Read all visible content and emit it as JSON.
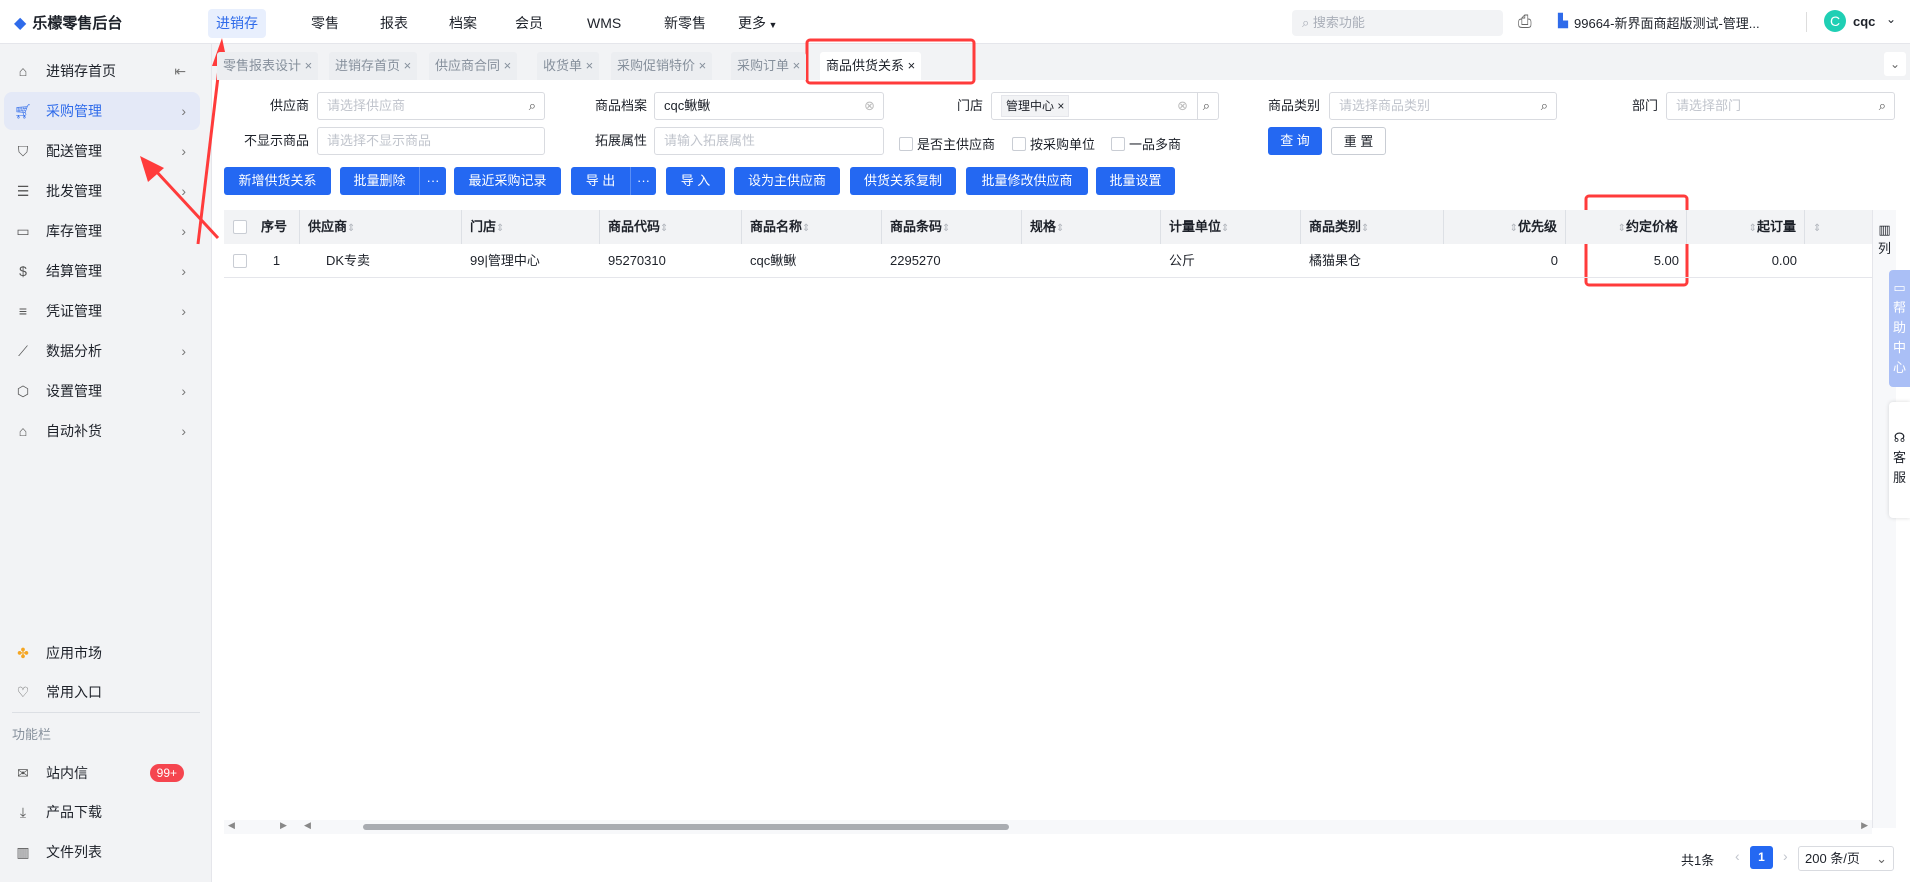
{
  "app": {
    "title": "乐檬零售后台"
  },
  "topnav": {
    "items": [
      {
        "label": "进销存",
        "active": true
      },
      {
        "label": "零售"
      },
      {
        "label": "报表"
      },
      {
        "label": "档案"
      },
      {
        "label": "会员"
      },
      {
        "label": "WMS"
      },
      {
        "label": "新零售"
      },
      {
        "label": "更多"
      }
    ],
    "search_placeholder": "搜索功能",
    "store": "99664-新界面商超版测试-管理...",
    "user_initial": "C",
    "user": "cqc"
  },
  "sidebar": {
    "items": [
      {
        "label": "进销存首页",
        "icon": "home-icon"
      },
      {
        "label": "采购管理",
        "icon": "cart-icon",
        "active": true
      },
      {
        "label": "配送管理",
        "icon": "map-icon"
      },
      {
        "label": "批发管理",
        "icon": "server-icon"
      },
      {
        "label": "库存管理",
        "icon": "inbox-icon"
      },
      {
        "label": "结算管理",
        "icon": "dollar-icon"
      },
      {
        "label": "凭证管理",
        "icon": "document-icon"
      },
      {
        "label": "数据分析",
        "icon": "chart-icon"
      },
      {
        "label": "设置管理",
        "icon": "settings-icon"
      },
      {
        "label": "自动补货",
        "icon": "robot-icon"
      }
    ],
    "bottom": {
      "app_market": "应用市场",
      "favorites": "常用入口",
      "section": "功能栏",
      "messages": "站内信",
      "messages_badge": "99+",
      "downloads": "产品下载",
      "files": "文件列表"
    }
  },
  "tabs": [
    {
      "label": "零售报表设计"
    },
    {
      "label": "进销存首页"
    },
    {
      "label": "供应商合同"
    },
    {
      "label": "收货单"
    },
    {
      "label": "采购促销特价"
    },
    {
      "label": "采购订单"
    },
    {
      "label": "商品供货关系",
      "active": true
    }
  ],
  "filters": {
    "supplier": {
      "label": "供应商",
      "placeholder": "请选择供应商"
    },
    "product": {
      "label": "商品档案",
      "value": "cqc鳅鳅"
    },
    "store": {
      "label": "门店",
      "chip": "管理中心"
    },
    "category": {
      "label": "商品类别",
      "placeholder": "请选择商品类别"
    },
    "dept": {
      "label": "部门",
      "placeholder": "请选择部门"
    },
    "hide_products": {
      "label": "不显示商品",
      "placeholder": "请选择不显示商品"
    },
    "ext": {
      "label": "拓展属性",
      "placeholder": "请输入拓展属性"
    },
    "checkboxes": [
      "是否主供应商",
      "按采购单位",
      "一品多商"
    ],
    "query": "查 询",
    "reset": "重 置"
  },
  "toolbar": [
    "新增供货关系",
    "批量删除",
    "最近采购记录",
    "导 出",
    "导 入",
    "设为主供应商",
    "供货关系复制",
    "批量修改供应商",
    "批量设置"
  ],
  "table": {
    "columns": [
      "序号",
      "供应商",
      "门店",
      "商品代码",
      "商品名称",
      "商品条码",
      "规格",
      "计量单位",
      "商品类别",
      "优先级",
      "约定价格",
      "起订量"
    ],
    "rows": [
      [
        "1",
        "DK专卖",
        "99|管理中心",
        "95270310",
        "cqc鳅鳅",
        "2295270",
        "",
        "公斤",
        "橘猫果仓",
        "0",
        "5.00",
        "0.00"
      ]
    ],
    "column_settings": "列"
  },
  "side_tabs": {
    "help": "帮助中心",
    "service": "客服"
  },
  "pagination": {
    "total": "共1条",
    "page": "1",
    "page_size": "200 条/页"
  },
  "colors": {
    "accent": "#2468f2",
    "annotation": "#ff3b3b"
  }
}
